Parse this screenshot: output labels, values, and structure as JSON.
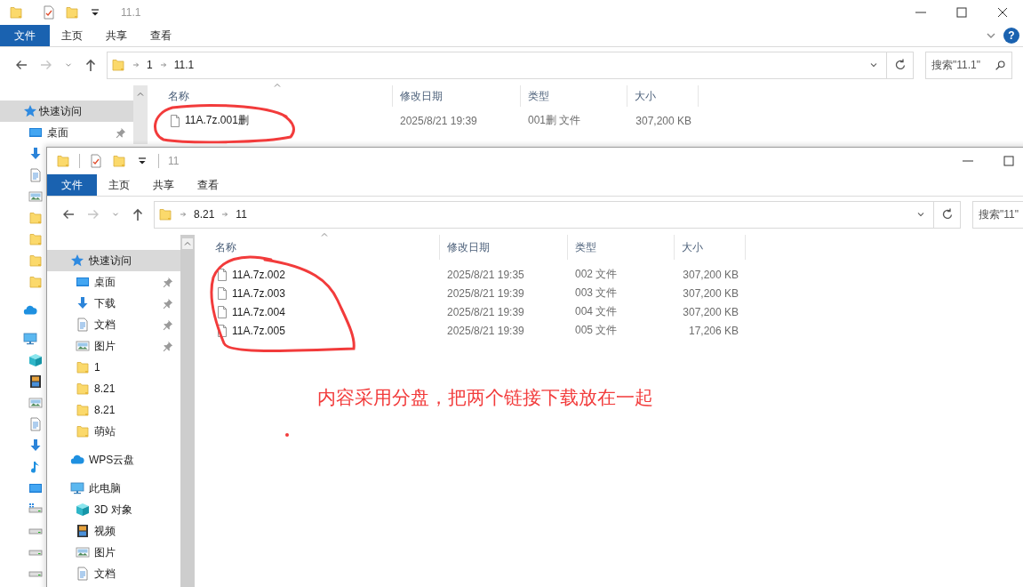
{
  "windows": [
    {
      "title": "11.1",
      "ribbon_tabs": [
        {
          "label": "文件",
          "kind": "file"
        },
        {
          "label": "主页",
          "kind": "tab"
        },
        {
          "label": "共享",
          "kind": "tab"
        },
        {
          "label": "查看",
          "kind": "tab"
        }
      ],
      "help": "?",
      "forward_disabled": true,
      "path": [
        "1",
        "11.1"
      ],
      "search_placeholder": "搜索\"11.1\"",
      "sidebar": [
        {
          "label": "快速访问",
          "kind": "star",
          "selected": true,
          "children": [
            {
              "label": "桌面",
              "kind": "desktop",
              "selected": false,
              "pinned": true
            },
            {
              "kind": "download",
              "selected": false,
              "pinned": false
            },
            {
              "kind": "document",
              "selected": false,
              "pinned": false
            },
            {
              "kind": "picture",
              "selected": false,
              "pinned": false
            },
            {
              "kind": "folder",
              "selected": false,
              "pinned": false
            },
            {
              "kind": "folder",
              "selected": false,
              "pinned": false
            },
            {
              "kind": "folder",
              "selected": false,
              "pinned": false
            },
            {
              "kind": "folder",
              "selected": false,
              "pinned": false
            }
          ]
        },
        {
          "kind": "cloud",
          "selected": false
        },
        {
          "kind": "pc",
          "selected": false,
          "children": [
            {
              "kind": "cube",
              "selected": false,
              "pinned": false
            },
            {
              "kind": "video",
              "selected": false,
              "pinned": false
            },
            {
              "kind": "picture",
              "selected": false,
              "pinned": false
            },
            {
              "kind": "document",
              "selected": false,
              "pinned": false
            },
            {
              "kind": "download",
              "selected": false,
              "pinned": false
            },
            {
              "kind": "music",
              "selected": false,
              "pinned": false
            },
            {
              "kind": "desktop",
              "selected": false,
              "pinned": false
            },
            {
              "kind": "system-drive",
              "selected": false,
              "pinned": false
            },
            {
              "kind": "drive",
              "selected": false,
              "pinned": false
            },
            {
              "kind": "drive",
              "selected": false,
              "pinned": false
            },
            {
              "kind": "drive",
              "selected": false,
              "pinned": false
            }
          ]
        }
      ],
      "columns": [
        {
          "label": "名称",
          "sorted": true
        },
        {
          "label": "修改日期",
          "sorted": false
        },
        {
          "label": "类型",
          "sorted": false
        },
        {
          "label": "大小",
          "sorted": false
        }
      ],
      "rows": [
        {
          "name": "11A.7z.001删",
          "modified": "2025/8/21 19:39",
          "type": "001删 文件",
          "size": "307,200 KB"
        }
      ]
    },
    {
      "title": "11",
      "ribbon_tabs": [
        {
          "label": "文件",
          "kind": "file"
        },
        {
          "label": "主页",
          "kind": "tab"
        },
        {
          "label": "共享",
          "kind": "tab"
        },
        {
          "label": "查看",
          "kind": "tab"
        }
      ],
      "forward_disabled": true,
      "path": [
        "8.21",
        "11"
      ],
      "search_placeholder": "搜索\"11\"",
      "sidebar": [
        {
          "label": "快速访问",
          "kind": "star",
          "selected": true,
          "children": [
            {
              "label": "桌面",
              "kind": "desktop",
              "selected": false,
              "pinned": true
            },
            {
              "label": "下载",
              "kind": "download",
              "selected": false,
              "pinned": true
            },
            {
              "label": "文档",
              "kind": "document",
              "selected": false,
              "pinned": true
            },
            {
              "label": "图片",
              "kind": "picture",
              "selected": false,
              "pinned": true
            },
            {
              "label": "1",
              "kind": "folder",
              "selected": false,
              "pinned": false
            },
            {
              "label": "8.21",
              "kind": "folder",
              "selected": false,
              "pinned": false
            },
            {
              "label": "8.21",
              "kind": "folder",
              "selected": false,
              "pinned": false
            },
            {
              "label": "萌站",
              "kind": "folder",
              "selected": false,
              "pinned": false
            }
          ]
        },
        {
          "label": "WPS云盘",
          "kind": "cloud",
          "selected": false
        },
        {
          "label": "此电脑",
          "kind": "pc",
          "selected": false,
          "children": [
            {
              "label": "3D 对象",
              "kind": "cube",
              "selected": false,
              "pinned": false
            },
            {
              "label": "视频",
              "kind": "video",
              "selected": false,
              "pinned": false
            },
            {
              "label": "图片",
              "kind": "picture",
              "selected": false,
              "pinned": false
            },
            {
              "label": "文档",
              "kind": "document",
              "selected": false,
              "pinned": false
            }
          ]
        }
      ],
      "columns": [
        {
          "label": "名称",
          "sorted": true
        },
        {
          "label": "修改日期",
          "sorted": false
        },
        {
          "label": "类型",
          "sorted": false
        },
        {
          "label": "大小",
          "sorted": false
        }
      ],
      "rows": [
        {
          "name": "11A.7z.002",
          "modified": "2025/8/21 19:35",
          "type": "002 文件",
          "size": "307,200 KB"
        },
        {
          "name": "11A.7z.003",
          "modified": "2025/8/21 19:39",
          "type": "003 文件",
          "size": "307,200 KB"
        },
        {
          "name": "11A.7z.004",
          "modified": "2025/8/21 19:39",
          "type": "004 文件",
          "size": "307,200 KB"
        },
        {
          "name": "11A.7z.005",
          "modified": "2025/8/21 19:39",
          "type": "005 文件",
          "size": "17,206 KB"
        }
      ]
    }
  ],
  "annotation": {
    "note": "内容采用分盘，把两个链接下载放在一起"
  }
}
